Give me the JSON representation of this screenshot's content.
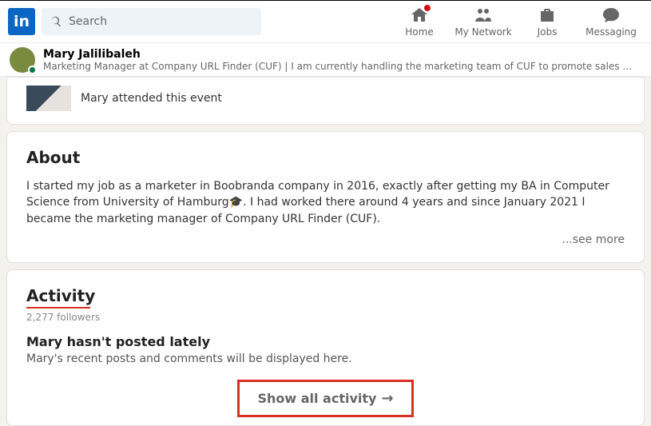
{
  "search": {
    "placeholder": "Search"
  },
  "nav": {
    "home": "Home",
    "network": "My Network",
    "jobs": "Jobs",
    "messaging": "Messaging"
  },
  "profile": {
    "name": "Mary Jalilibaleh",
    "headline": "Marketing Manager at Company URL Finder (CUF) | I am currently handling the marketing team of CUF to promote sales 💡 #digitalmarke..."
  },
  "event": {
    "text": "Mary attended this event"
  },
  "about": {
    "heading": "About",
    "body": "I started my job as a marketer in Boobranda company in 2016, exactly after getting my BA in Computer Science from University of Hamburg🎓. I had worked there around 4 years and since January 2021 I became the marketing manager of Company URL Finder (CUF).",
    "see_more": "...see more"
  },
  "activity": {
    "heading": "Activity",
    "followers": "2,277 followers",
    "empty_title": "Mary hasn't posted lately",
    "empty_sub": "Mary's recent posts and comments will be displayed here.",
    "show_all": "Show all activity"
  }
}
